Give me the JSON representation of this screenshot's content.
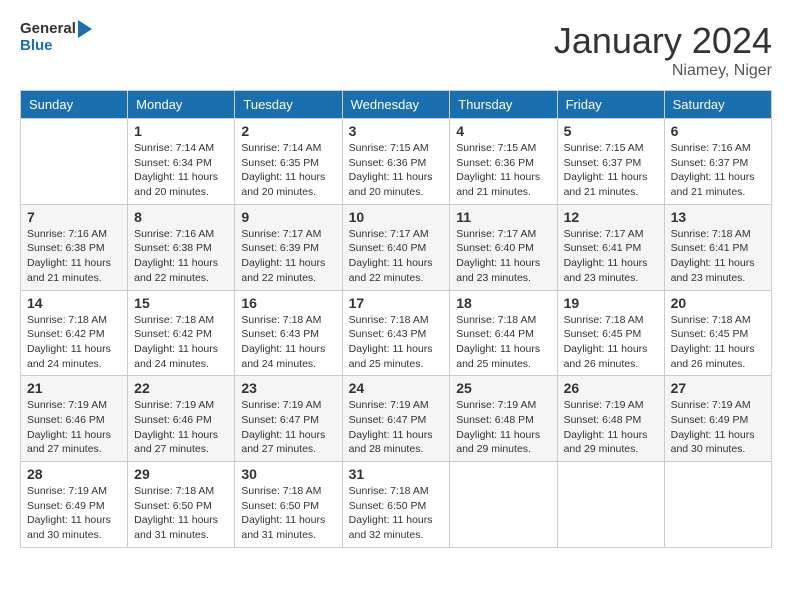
{
  "header": {
    "logo_line1": "General",
    "logo_line2": "Blue",
    "title": "January 2024",
    "subtitle": "Niamey, Niger"
  },
  "days_of_week": [
    "Sunday",
    "Monday",
    "Tuesday",
    "Wednesday",
    "Thursday",
    "Friday",
    "Saturday"
  ],
  "weeks": [
    [
      {
        "day": "",
        "detail": ""
      },
      {
        "day": "1",
        "detail": "Sunrise: 7:14 AM\nSunset: 6:34 PM\nDaylight: 11 hours\nand 20 minutes."
      },
      {
        "day": "2",
        "detail": "Sunrise: 7:14 AM\nSunset: 6:35 PM\nDaylight: 11 hours\nand 20 minutes."
      },
      {
        "day": "3",
        "detail": "Sunrise: 7:15 AM\nSunset: 6:36 PM\nDaylight: 11 hours\nand 20 minutes."
      },
      {
        "day": "4",
        "detail": "Sunrise: 7:15 AM\nSunset: 6:36 PM\nDaylight: 11 hours\nand 21 minutes."
      },
      {
        "day": "5",
        "detail": "Sunrise: 7:15 AM\nSunset: 6:37 PM\nDaylight: 11 hours\nand 21 minutes."
      },
      {
        "day": "6",
        "detail": "Sunrise: 7:16 AM\nSunset: 6:37 PM\nDaylight: 11 hours\nand 21 minutes."
      }
    ],
    [
      {
        "day": "7",
        "detail": "Sunrise: 7:16 AM\nSunset: 6:38 PM\nDaylight: 11 hours\nand 21 minutes."
      },
      {
        "day": "8",
        "detail": "Sunrise: 7:16 AM\nSunset: 6:38 PM\nDaylight: 11 hours\nand 22 minutes."
      },
      {
        "day": "9",
        "detail": "Sunrise: 7:17 AM\nSunset: 6:39 PM\nDaylight: 11 hours\nand 22 minutes."
      },
      {
        "day": "10",
        "detail": "Sunrise: 7:17 AM\nSunset: 6:40 PM\nDaylight: 11 hours\nand 22 minutes."
      },
      {
        "day": "11",
        "detail": "Sunrise: 7:17 AM\nSunset: 6:40 PM\nDaylight: 11 hours\nand 23 minutes."
      },
      {
        "day": "12",
        "detail": "Sunrise: 7:17 AM\nSunset: 6:41 PM\nDaylight: 11 hours\nand 23 minutes."
      },
      {
        "day": "13",
        "detail": "Sunrise: 7:18 AM\nSunset: 6:41 PM\nDaylight: 11 hours\nand 23 minutes."
      }
    ],
    [
      {
        "day": "14",
        "detail": "Sunrise: 7:18 AM\nSunset: 6:42 PM\nDaylight: 11 hours\nand 24 minutes."
      },
      {
        "day": "15",
        "detail": "Sunrise: 7:18 AM\nSunset: 6:42 PM\nDaylight: 11 hours\nand 24 minutes."
      },
      {
        "day": "16",
        "detail": "Sunrise: 7:18 AM\nSunset: 6:43 PM\nDaylight: 11 hours\nand 24 minutes."
      },
      {
        "day": "17",
        "detail": "Sunrise: 7:18 AM\nSunset: 6:43 PM\nDaylight: 11 hours\nand 25 minutes."
      },
      {
        "day": "18",
        "detail": "Sunrise: 7:18 AM\nSunset: 6:44 PM\nDaylight: 11 hours\nand 25 minutes."
      },
      {
        "day": "19",
        "detail": "Sunrise: 7:18 AM\nSunset: 6:45 PM\nDaylight: 11 hours\nand 26 minutes."
      },
      {
        "day": "20",
        "detail": "Sunrise: 7:18 AM\nSunset: 6:45 PM\nDaylight: 11 hours\nand 26 minutes."
      }
    ],
    [
      {
        "day": "21",
        "detail": "Sunrise: 7:19 AM\nSunset: 6:46 PM\nDaylight: 11 hours\nand 27 minutes."
      },
      {
        "day": "22",
        "detail": "Sunrise: 7:19 AM\nSunset: 6:46 PM\nDaylight: 11 hours\nand 27 minutes."
      },
      {
        "day": "23",
        "detail": "Sunrise: 7:19 AM\nSunset: 6:47 PM\nDaylight: 11 hours\nand 27 minutes."
      },
      {
        "day": "24",
        "detail": "Sunrise: 7:19 AM\nSunset: 6:47 PM\nDaylight: 11 hours\nand 28 minutes."
      },
      {
        "day": "25",
        "detail": "Sunrise: 7:19 AM\nSunset: 6:48 PM\nDaylight: 11 hours\nand 29 minutes."
      },
      {
        "day": "26",
        "detail": "Sunrise: 7:19 AM\nSunset: 6:48 PM\nDaylight: 11 hours\nand 29 minutes."
      },
      {
        "day": "27",
        "detail": "Sunrise: 7:19 AM\nSunset: 6:49 PM\nDaylight: 11 hours\nand 30 minutes."
      }
    ],
    [
      {
        "day": "28",
        "detail": "Sunrise: 7:19 AM\nSunset: 6:49 PM\nDaylight: 11 hours\nand 30 minutes."
      },
      {
        "day": "29",
        "detail": "Sunrise: 7:18 AM\nSunset: 6:50 PM\nDaylight: 11 hours\nand 31 minutes."
      },
      {
        "day": "30",
        "detail": "Sunrise: 7:18 AM\nSunset: 6:50 PM\nDaylight: 11 hours\nand 31 minutes."
      },
      {
        "day": "31",
        "detail": "Sunrise: 7:18 AM\nSunset: 6:50 PM\nDaylight: 11 hours\nand 32 minutes."
      },
      {
        "day": "",
        "detail": ""
      },
      {
        "day": "",
        "detail": ""
      },
      {
        "day": "",
        "detail": ""
      }
    ]
  ]
}
